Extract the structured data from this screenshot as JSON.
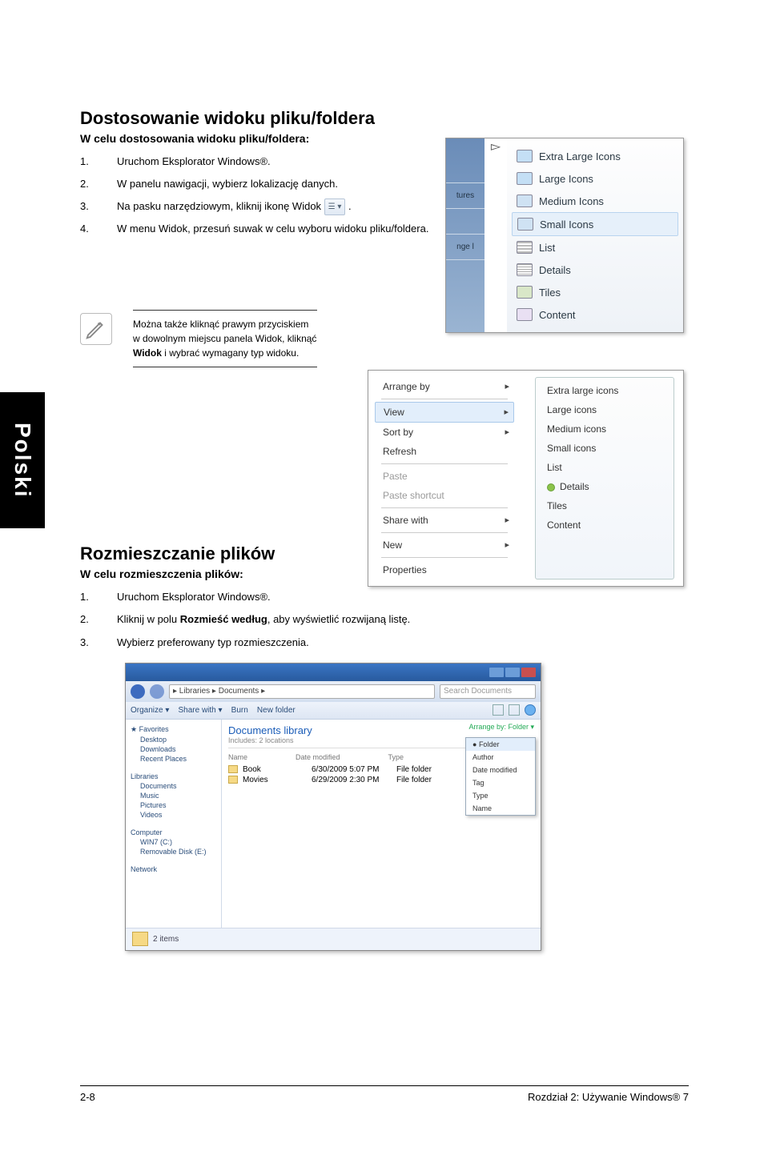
{
  "side_tab": "Polski",
  "section1": {
    "heading": "Dostosowanie widoku pliku/foldera",
    "subhead": "W celu dostosowania widoku pliku/foldera:",
    "steps": [
      {
        "num": "1.",
        "text": "Uruchom Eksplorator Windows®."
      },
      {
        "num": "2.",
        "text": "W panelu nawigacji, wybierz lokalizację danych."
      },
      {
        "num": "3.",
        "text_pre": "Na pasku narzędziowym, kliknij ikonę Widok ",
        "text_post": "."
      },
      {
        "num": "4.",
        "text": "W menu Widok, przesuń suwak w celu wyboru widoku pliku/foldera."
      }
    ]
  },
  "view_menu": {
    "left_labels": [
      "",
      "tures",
      "",
      "nge l"
    ],
    "items": [
      "Extra Large Icons",
      "Large Icons",
      "Medium Icons",
      "Small Icons",
      "List",
      "Details",
      "Tiles",
      "Content"
    ],
    "selected": "Small Icons"
  },
  "note": {
    "text_parts": [
      "Można także kliknąć prawym przyciskiem w dowolnym miejscu panela Widok, kliknąć ",
      "Widok",
      " i wybrać wymagany typ widoku."
    ]
  },
  "context_menu": {
    "left": [
      {
        "label": "Arrange by",
        "arrow": true
      },
      {
        "label": "View",
        "arrow": true,
        "hl": true
      },
      {
        "label": "Sort by",
        "arrow": true
      },
      {
        "label": "Refresh"
      },
      {
        "sep": true
      },
      {
        "label": "Paste",
        "dim": true
      },
      {
        "label": "Paste shortcut",
        "dim": true
      },
      {
        "sep": true
      },
      {
        "label": "Share with",
        "arrow": true
      },
      {
        "sep": true
      },
      {
        "label": "New",
        "arrow": true
      },
      {
        "sep": true
      },
      {
        "label": "Properties"
      }
    ],
    "right": [
      "Extra large icons",
      "Large icons",
      "Medium icons",
      "Small icons",
      "List",
      "Details",
      "Tiles",
      "Content"
    ],
    "right_selected": "Details"
  },
  "section2": {
    "heading": "Rozmieszczanie plików",
    "subhead": "W celu rozmieszczenia plików:",
    "steps": [
      {
        "num": "1.",
        "text": "Uruchom Eksplorator Windows®."
      },
      {
        "num": "2.",
        "text_parts": [
          "Kliknij w polu ",
          "Rozmieść według",
          ", aby wyświetlić rozwijaną listę."
        ]
      },
      {
        "num": "3.",
        "text": "Wybierz preferowany typ rozmieszczenia."
      }
    ]
  },
  "explorer": {
    "path": "▸ Libraries ▸ Documents ▸",
    "search_placeholder": "Search Documents",
    "toolbar": {
      "organize": "Organize ▾",
      "share": "Share with ▾",
      "burn": "Burn",
      "new_folder": "New folder"
    },
    "nav": {
      "favorites": {
        "hd": "★ Favorites",
        "items": [
          "Desktop",
          "Downloads",
          "Recent Places"
        ]
      },
      "libraries": {
        "hd": "Libraries",
        "items": [
          "Documents",
          "Music",
          "Pictures",
          "Videos"
        ]
      },
      "computer": {
        "hd": "Computer",
        "items": [
          "WIN7 (C:)",
          "Removable Disk (E:)"
        ]
      },
      "network": {
        "hd": "Network"
      }
    },
    "lib_hd": "Documents library",
    "lib_sub": "Includes: 2 locations",
    "arrange_label": "Arrange by:  Folder ▾",
    "cols": [
      "Name",
      "Date modified",
      "Type"
    ],
    "items": [
      {
        "name": "Book",
        "date": "6/30/2009 5:07 PM",
        "type": "File folder"
      },
      {
        "name": "Movies",
        "date": "6/29/2009 2:30 PM",
        "type": "File folder"
      }
    ],
    "arrange_menu": [
      "Folder",
      "Author",
      "Date modified",
      "Tag",
      "Type",
      "Name"
    ],
    "arrange_selected": "Folder",
    "status": "2 items"
  },
  "footer": {
    "left": "2-8",
    "right": "Rozdział 2: Używanie Windows® 7"
  }
}
